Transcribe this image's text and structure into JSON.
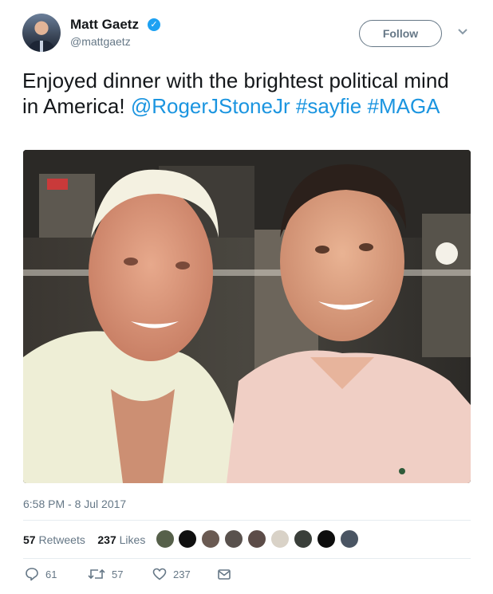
{
  "user": {
    "name": "Matt Gaetz",
    "handle": "@mattgaetz",
    "verified_icon": "verified-badge-icon"
  },
  "follow_label": "Follow",
  "tweet": {
    "text_plain": "Enjoyed dinner with the brightest political mind in America! ",
    "mention": "@RogerJStoneJr",
    "hashtag1": "#sayfie",
    "hashtag2": "#MAGA"
  },
  "timestamp": "6:58 PM - 8 Jul 2017",
  "stats": {
    "retweets_count": "57",
    "retweets_label": "Retweets",
    "likes_count": "237",
    "likes_label": "Likes"
  },
  "actions": {
    "reply_count": "61",
    "retweet_count": "57",
    "like_count": "237"
  },
  "colors": {
    "link": "#1b95e0",
    "verified": "#1da1f2",
    "secondary_text": "#657786"
  },
  "icons": [
    "reply-icon",
    "retweet-icon",
    "like-icon",
    "direct-message-icon",
    "caret-down-icon"
  ]
}
